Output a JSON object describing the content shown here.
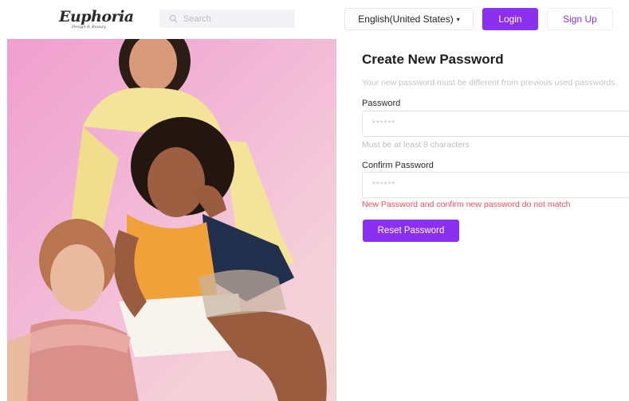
{
  "header": {
    "logo_text": "Euphoria",
    "logo_tagline": "Design & Beauty",
    "search_placeholder": "Search",
    "language": "English(United States)",
    "login_label": "Login",
    "signup_label": "Sign Up"
  },
  "form": {
    "title": "Create New Password",
    "subtitle": "Your new password must be different from previous used passwords.",
    "password_label": "Password",
    "password_placeholder": "******",
    "password_hint": "Must be at least 8 characters",
    "confirm_label": "Confirm Password",
    "confirm_placeholder": "******",
    "error_text": "New Password and confirm new password do not match",
    "submit_label": "Reset Password"
  },
  "colors": {
    "accent": "#8b2ff0",
    "error": "#ef4f5e",
    "hero_background": "#f2b6d6"
  },
  "icons": {
    "search": "search-icon",
    "caret": "caret-down-icon"
  }
}
